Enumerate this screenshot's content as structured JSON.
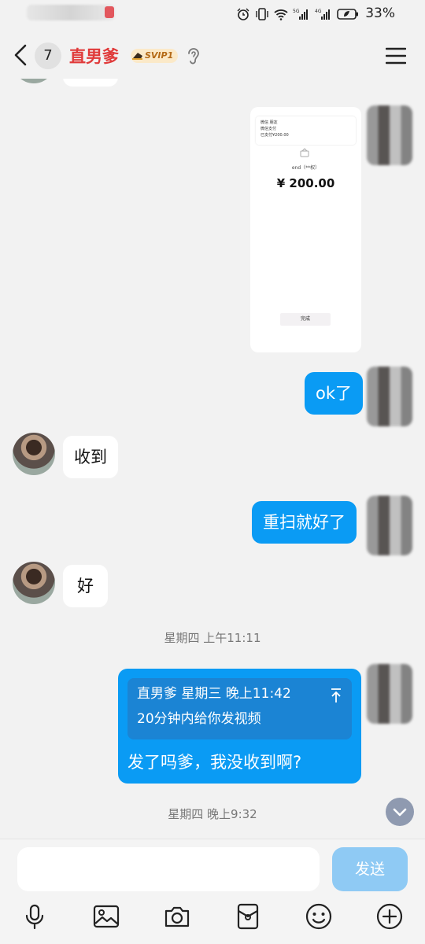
{
  "status_bar": {
    "battery_percent": "33%",
    "icons": [
      "alarm-icon",
      "vibrate-icon",
      "wifi-icon",
      "signal-5g-icon",
      "signal-4g-icon",
      "battery-icon"
    ]
  },
  "header": {
    "unread_count": "7",
    "title": "直男爹",
    "badge": "SVIP1"
  },
  "messages": {
    "payment_image": {
      "card_line1": "微信 朋友",
      "card_line2": "微信支付",
      "card_line3": "已支付¥200.00",
      "recipient": "end（**权）",
      "amount": "¥ 200.00",
      "done_button": "完成"
    },
    "out_1": "ok了",
    "in_1": "收到",
    "out_2": "重扫就好了",
    "in_2": "好",
    "time_1": "星期四 上午11:11",
    "quote_header": "直男爹 星期三 晚上11:42",
    "quote_text": "20分钟内给你发视频",
    "out_3": "发了吗爹，我没收到啊?",
    "time_2": "星期四 晚上9:32"
  },
  "input": {
    "value": "",
    "send_label": "发送"
  },
  "toolbar": [
    "mic-icon",
    "image-icon",
    "camera-icon",
    "red-packet-icon",
    "emoji-icon",
    "plus-icon"
  ],
  "colors": {
    "title": "#e03a3a",
    "bubble_out": "#0a9bf4",
    "send_disabled": "#8fcaf4"
  }
}
